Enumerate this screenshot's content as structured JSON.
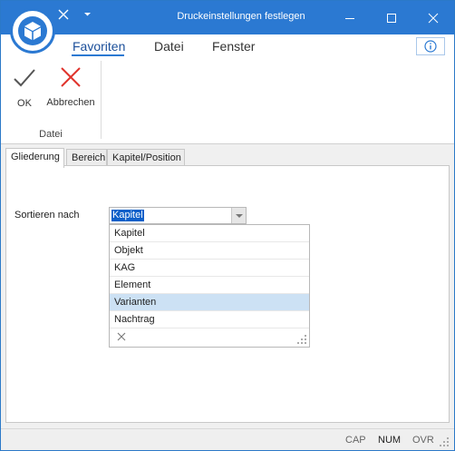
{
  "window": {
    "title": "Druckeinstellungen festlegen"
  },
  "ribbon": {
    "tabs": [
      {
        "label": "Favoriten",
        "active": true
      },
      {
        "label": "Datei",
        "active": false
      },
      {
        "label": "Fenster",
        "active": false
      }
    ],
    "group": {
      "label": "Datei",
      "buttons": [
        {
          "label": "OK",
          "icon": "checkmark-icon"
        },
        {
          "label": "Abbrechen",
          "icon": "cancel-x-icon"
        }
      ]
    }
  },
  "dialog": {
    "tabs": [
      {
        "label": "Gliederung",
        "active": true
      },
      {
        "label": "Bereich",
        "active": false
      },
      {
        "label": "Kapitel/Position",
        "active": false
      }
    ],
    "sort": {
      "label": "Sortieren nach",
      "value": "Kapitel",
      "options": [
        "Kapitel",
        "Objekt",
        "KAG",
        "Element",
        "Varianten",
        "Nachtrag"
      ],
      "hovered": "Varianten"
    }
  },
  "status": {
    "items": [
      "CAP",
      "NUM",
      "OVR"
    ],
    "active": [
      "NUM"
    ]
  },
  "colors": {
    "titlebar": "#2b79d2",
    "selection": "#0e60c9",
    "hover": "#cce1f4"
  }
}
